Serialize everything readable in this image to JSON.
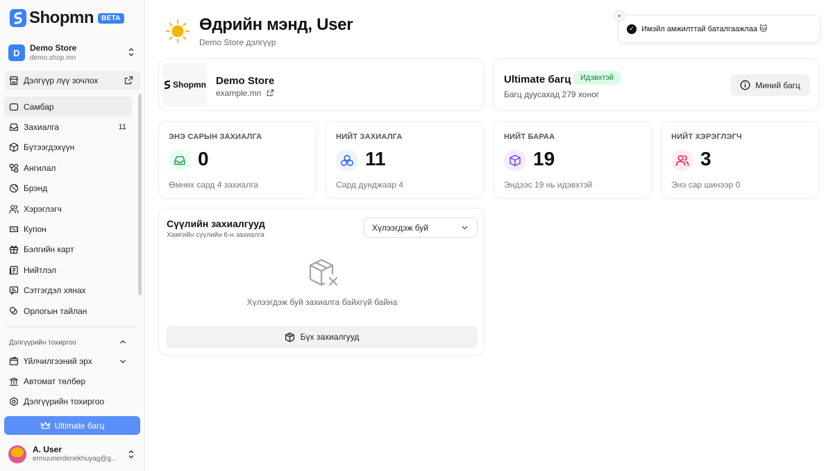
{
  "app": {
    "logo": "Shopmn",
    "beta": "BETA"
  },
  "store_switcher": {
    "initial": "D",
    "name": "Demo Store",
    "domain": "demo.shop.mn"
  },
  "visit_store": "Дэлгүүр лүү зочлох",
  "nav": [
    {
      "label": "Самбар",
      "icon": "dashboard-icon",
      "active": true
    },
    {
      "label": "Захиалга",
      "icon": "inbox-icon",
      "count": "11"
    },
    {
      "label": "Бүтээгдэхүүн",
      "icon": "box-icon"
    },
    {
      "label": "Ангилал",
      "icon": "category-icon"
    },
    {
      "label": "Брэнд",
      "icon": "brand-icon"
    },
    {
      "label": "Хэрэглэгч",
      "icon": "users-icon"
    },
    {
      "label": "Купон",
      "icon": "ticket-icon"
    },
    {
      "label": "Бэлгийн карт",
      "icon": "gift-icon"
    },
    {
      "label": "Нийтлэл",
      "icon": "article-icon"
    },
    {
      "label": "Сэтгэгдэл хянах",
      "icon": "comment-icon"
    },
    {
      "label": "Орлогын тайлан",
      "icon": "coins-icon"
    }
  ],
  "settings_section": {
    "title": "Дэлгүүрийн тохиргоо",
    "items": [
      {
        "label": "Үйлчилгээний эрх",
        "icon": "wallet-icon"
      },
      {
        "label": "Автомат төлбөр",
        "icon": "bank-icon"
      },
      {
        "label": "Дэлгүүрийн тохиргоо",
        "icon": "settings-icon"
      }
    ]
  },
  "upgrade_button": "Ultimate багц",
  "user": {
    "name": "A. User",
    "email": "ermuunerdenekhuyag@g..."
  },
  "header": {
    "greeting": "Өдрийн мэнд, User",
    "subtitle": "Demo Store дэлгүүр"
  },
  "toast": {
    "message": "Имэйл амжилттай баталгаажлаа 🐱",
    "close": "×"
  },
  "store_card": {
    "name": "Demo Store",
    "url": "example.mn",
    "logo_text": "Shopmn"
  },
  "plan_card": {
    "title": "Ultimate багц",
    "badge": "Идэвхтэй",
    "subtitle": "Багц дуусахад 279 хоног",
    "button": "Миний багц"
  },
  "stats": [
    {
      "label": "ЭНЭ САРЫН ЗАХИАЛГА",
      "value": "0",
      "foot": "Өмнөх сард 4 захиалга",
      "color": "#16a34a",
      "bg": "#ecfdf3"
    },
    {
      "label": "НИЙТ ЗАХИАЛГА",
      "value": "11",
      "foot": "Сард дунджаар 4",
      "color": "#2563eb",
      "bg": "#eef4ff"
    },
    {
      "label": "НИЙТ БАРАА",
      "value": "19",
      "foot": "Эндээс 19 нь идэвхтэй",
      "color": "#7c3aed",
      "bg": "#f3eeff"
    },
    {
      "label": "НИЙТ ХЭРЭГЛЭГЧ",
      "value": "3",
      "foot": "Энэ сар шинээр 0",
      "color": "#e11d48",
      "bg": "#ffeef1"
    }
  ],
  "recent_orders": {
    "title": "Сүүлийн захиалгууд",
    "subtitle": "Хамгийн сүүлийн 6-н захиалга",
    "filter": "Хүлээгдэж буй",
    "empty": "Хүлээгдэж буй захиалга байхгүй байна",
    "all_button": "Бүх захиалгууд"
  }
}
